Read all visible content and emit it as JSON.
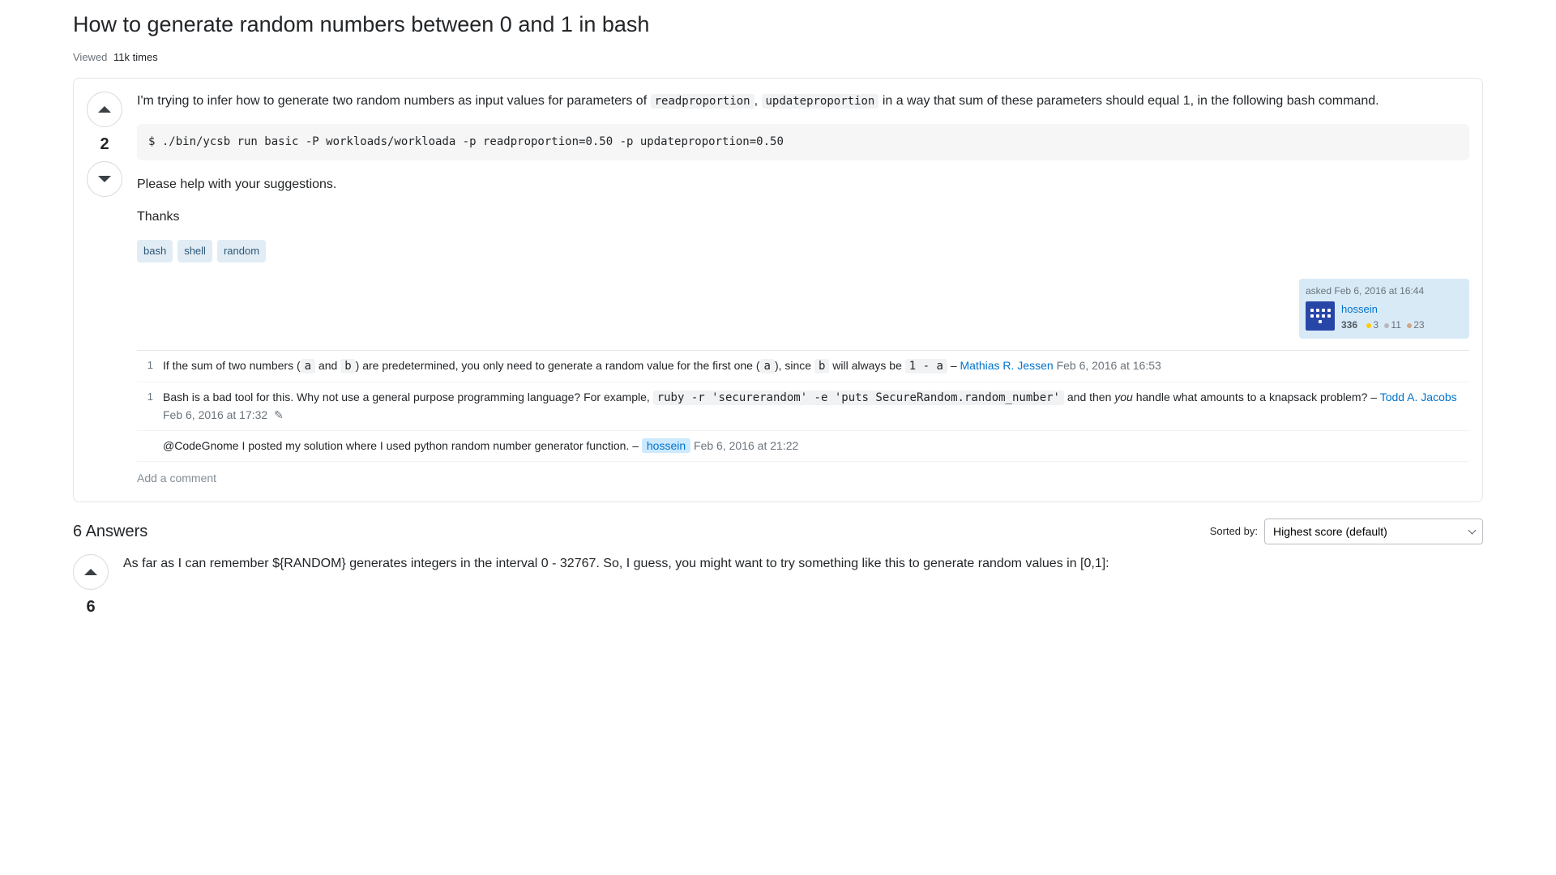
{
  "question": {
    "title": "How to generate random numbers between 0 and 1 in bash",
    "stats": {
      "viewed_label": "Viewed",
      "viewed_value": "11k times"
    },
    "vote_score": "2",
    "body": {
      "p1_pre": "I'm trying to infer how to generate two random numbers as input values for parameters of ",
      "code1": "readproportion",
      "p1_mid": ", ",
      "code2": "updateproportion",
      "p1_post": " in a way that sum of these parameters should equal 1, in the following bash command.",
      "codeblock": "$ ./bin/ycsb run basic -P workloads/workloada -p readproportion=0.50 -p updateproportion=0.50",
      "p2": "Please help with your suggestions.",
      "p3": "Thanks"
    },
    "tags": [
      "bash",
      "shell",
      "random"
    ],
    "owner": {
      "asked_label": "asked",
      "asked_time": "Feb 6, 2016 at 16:44",
      "username": "hossein",
      "rep": "336",
      "gold": "3",
      "silver": "11",
      "bronze": "23"
    }
  },
  "comments": [
    {
      "score": "1",
      "text_pre": "If the sum of two numbers (",
      "code_a": "a",
      "text_mid1": " and ",
      "code_b": "b",
      "text_mid2": ") are predetermined, you only need to generate a random value for the first one (",
      "code_a2": "a",
      "text_mid3": "), since ",
      "code_b2": "b",
      "text_mid4": " will always be ",
      "code_expr": "1 - a",
      "dash": " – ",
      "author": "Mathias R. Jessen",
      "date": "Feb 6, 2016 at 16:53"
    },
    {
      "score": "1",
      "text_pre": "Bash is a bad tool for this. Why not use a general purpose programming language? For example, ",
      "code": "ruby -r 'securerandom' -e 'puts SecureRandom.random_number'",
      "text_mid1": " and then ",
      "em": "you",
      "text_mid2": " handle what amounts to a knapsack problem?",
      "dash": " – ",
      "author": "Todd A. Jacobs",
      "date": "Feb 6, 2016 at 17:32"
    },
    {
      "score": "",
      "text": "@CodeGnome I posted my solution where I used python random number generator function.",
      "dash": " – ",
      "author": "hossein",
      "date": "Feb 6, 2016 at 21:22"
    }
  ],
  "add_comment": "Add a comment",
  "answers": {
    "heading": "6 Answers",
    "sort_label": "Sorted by:",
    "sort_value": "Highest score (default)",
    "first": {
      "vote_score": "6",
      "p1": "As far as I can remember ${RANDOM} generates integers in the interval 0 - 32767. So, I guess, you might want to try something like this to generate random values in [0,1]:"
    }
  }
}
